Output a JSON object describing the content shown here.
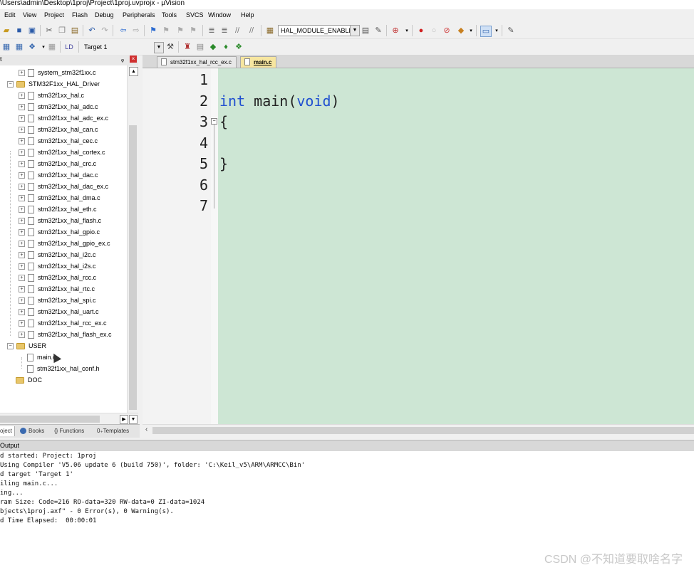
{
  "window": {
    "title": "\\Users\\admin\\Desktop\\1proj\\Project\\1proj.uvprojx - µVision"
  },
  "menu": [
    "Edit",
    "View",
    "Project",
    "Flash",
    "Debug",
    "Peripherals",
    "Tools",
    "SVCS",
    "Window",
    "Help"
  ],
  "toolbar1": {
    "define_combo": "HAL_MODULE_ENABLED",
    "icons": [
      "open-icon",
      "save-icon",
      "save-all-icon",
      "cut-icon",
      "copy-icon",
      "paste-icon",
      "undo-icon",
      "redo-icon",
      "back-icon",
      "forward-icon",
      "bookmark-icon",
      "prev-bookmark-icon",
      "next-bookmark-icon",
      "clear-bookmark-icon",
      "indent-icon",
      "unindent-icon",
      "comment-icon",
      "uncomment-icon",
      "find-in-files-icon",
      "find-icon",
      "debug-icon",
      "breakpoint-icon",
      "disable-breakpoint-icon",
      "kill-breakpoints-icon",
      "window-icon",
      "configure-icon"
    ]
  },
  "toolbar2": {
    "target_combo": "Target 1"
  },
  "project_panel": {
    "header": "t",
    "tree": [
      {
        "label": "system_stm32f1xx.c",
        "type": "file",
        "indent": 2
      },
      {
        "label": "STM32F1xx_HAL_Driver",
        "type": "folder",
        "indent": 1
      },
      {
        "label": "stm32f1xx_hal.c",
        "type": "file",
        "indent": 2
      },
      {
        "label": "stm32f1xx_hal_adc.c",
        "type": "file",
        "indent": 2
      },
      {
        "label": "stm32f1xx_hal_adc_ex.c",
        "type": "file",
        "indent": 2
      },
      {
        "label": "stm32f1xx_hal_can.c",
        "type": "file",
        "indent": 2
      },
      {
        "label": "stm32f1xx_hal_cec.c",
        "type": "file",
        "indent": 2
      },
      {
        "label": "stm32f1xx_hal_cortex.c",
        "type": "file",
        "indent": 2
      },
      {
        "label": "stm32f1xx_hal_crc.c",
        "type": "file",
        "indent": 2
      },
      {
        "label": "stm32f1xx_hal_dac.c",
        "type": "file",
        "indent": 2
      },
      {
        "label": "stm32f1xx_hal_dac_ex.c",
        "type": "file",
        "indent": 2
      },
      {
        "label": "stm32f1xx_hal_dma.c",
        "type": "file",
        "indent": 2
      },
      {
        "label": "stm32f1xx_hal_eth.c",
        "type": "file",
        "indent": 2
      },
      {
        "label": "stm32f1xx_hal_flash.c",
        "type": "file",
        "indent": 2
      },
      {
        "label": "stm32f1xx_hal_gpio.c",
        "type": "file",
        "indent": 2
      },
      {
        "label": "stm32f1xx_hal_gpio_ex.c",
        "type": "file",
        "indent": 2
      },
      {
        "label": "stm32f1xx_hal_i2c.c",
        "type": "file",
        "indent": 2
      },
      {
        "label": "stm32f1xx_hal_i2s.c",
        "type": "file",
        "indent": 2
      },
      {
        "label": "stm32f1xx_hal_rcc.c",
        "type": "file",
        "indent": 2
      },
      {
        "label": "stm32f1xx_hal_rtc.c",
        "type": "file",
        "indent": 2
      },
      {
        "label": "stm32f1xx_hal_spi.c",
        "type": "file",
        "indent": 2
      },
      {
        "label": "stm32f1xx_hal_uart.c",
        "type": "file",
        "indent": 2
      },
      {
        "label": "stm32f1xx_hal_rcc_ex.c",
        "type": "file",
        "indent": 2
      },
      {
        "label": "stm32f1xx_hal_flash_ex.c",
        "type": "file",
        "indent": 2
      },
      {
        "label": "USER",
        "type": "folder",
        "indent": 1
      },
      {
        "label": "main.c",
        "type": "file-noexp",
        "indent": 2
      },
      {
        "label": "stm32f1xx_hal_conf.h",
        "type": "file-noexp",
        "indent": 2
      },
      {
        "label": "DOC",
        "type": "folder-noexp",
        "indent": 1
      }
    ],
    "tabs": [
      "oject",
      "Books",
      "Functions",
      "Templates"
    ]
  },
  "editor": {
    "tabs": [
      "stm32f1xx_hal_rcc_ex.c",
      "main.c"
    ],
    "active_tab": 1,
    "line_numbers": [
      "1",
      "2",
      "3",
      "4",
      "5",
      "6",
      "7"
    ],
    "code": {
      "l2_kw1": "int",
      "l2_mid": " main(",
      "l2_kw2": "void",
      "l2_end": ")",
      "l3": "{",
      "l5": "}"
    }
  },
  "output": {
    "header": "Output",
    "lines": [
      "d started: Project: 1proj",
      "Using Compiler 'V5.06 update 6 (build 750)', folder: 'C:\\Keil_v5\\ARM\\ARMCC\\Bin'",
      "d target 'Target 1'",
      "iling main.c...",
      "ing...",
      "ram Size: Code=216 RO-data=320 RW-data=0 ZI-data=1024",
      "bjects\\1proj.axf\" - 0 Error(s), 0 Warning(s).",
      "d Time Elapsed:  00:00:01"
    ]
  },
  "watermark": "CSDN @不知道要取啥名字",
  "colors": {
    "editor_bg": "#cde6d4",
    "keyword": "#2050d0",
    "active_tab": "#f7e6a0"
  }
}
